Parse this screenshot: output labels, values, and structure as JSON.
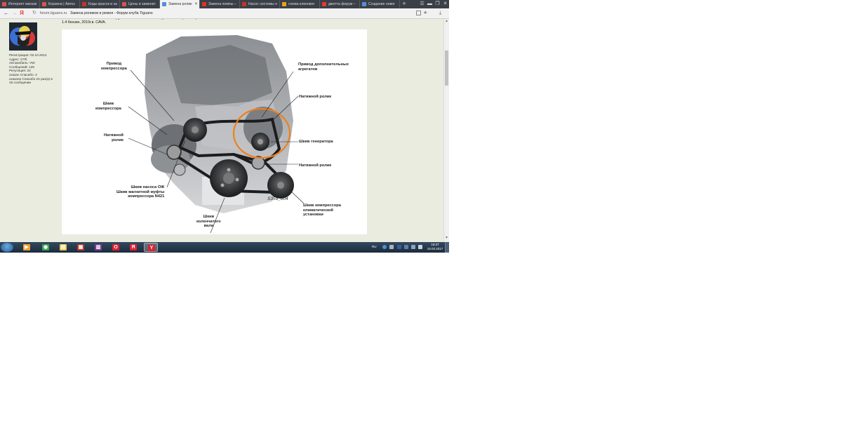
{
  "browser": {
    "tabs": [
      {
        "label": "Интернет магази",
        "color": "#d9534f"
      },
      {
        "label": "Корзина | Автоз",
        "color": "#d9534f"
      },
      {
        "label": "Коды красок и за",
        "color": "#c9302c"
      },
      {
        "label": "Цены и заменит",
        "color": "#d9534f"
      },
      {
        "label": "Замена ролик",
        "color": "#5b8dd6",
        "active": true
      },
      {
        "label": "Замена помпы –",
        "color": "#e52d27"
      },
      {
        "label": "Насос системы о",
        "color": "#c9302c"
      },
      {
        "label": "схема клиновог",
        "color": "#e8a317"
      },
      {
        "label": "джетта форум –",
        "color": "#e33b2e"
      },
      {
        "label": "Создание новог",
        "color": "#5b8dd6"
      }
    ],
    "new_tab": "+",
    "window_buttons": {
      "menu": "☰",
      "minimize": "▬",
      "restore": "❐",
      "close": "✕"
    },
    "nav": {
      "back": "←",
      "forward": "→",
      "yandex": "Я",
      "reload": "↻"
    },
    "url": "forum.tiguans.ru",
    "page_title": "Замена роликов и ремня - Форум клуба Tiguans"
  },
  "post": {
    "text_lines": [
      "натяжных? Связаны ли они между собой механически? Подскажите парт номер",
      "1.4 бензин, 2010г.в. CAVA."
    ]
  },
  "user": {
    "info_lines": [
      "Регистрация: 02.10.2012",
      "Адрес: СПб",
      "Автомобиль: VW",
      "Сообщений: 125",
      "Репутация: 24",
      "сказал Спасибо: 2",
      "сказали Спасибо 24 раз(а) в",
      "16 сообщении"
    ]
  },
  "diagram": {
    "labels": {
      "compressor_drive": [
        "Привод",
        "компрессора"
      ],
      "aux_drive": [
        "Привод дополнительных",
        "агрегатов"
      ],
      "tensioner_1": "Натяжной ролик",
      "compressor_pulley": [
        "Шкив",
        "компрессора"
      ],
      "generator_pulley": "Шкив генератора",
      "tensioner_left": [
        "Натяжной",
        "ролик"
      ],
      "tensioner_2": "Натяжной ролик",
      "pump_pulley": [
        "Шкив насоса ОЖ",
        "Шкив магнитной муфты",
        "компрессора N421"
      ],
      "ac_pulley": [
        "Шкив компрессора",
        "климатической",
        "установки"
      ],
      "crank_pulley": [
        "Шкив",
        "коленчатого",
        "вала"
      ]
    },
    "code": "S359_004",
    "highlight_color": "#f07f1c"
  },
  "taskbar": {
    "apps": [
      {
        "name": "media",
        "color": "#f0a030",
        "glyph": "▶"
      },
      {
        "name": "explorer",
        "color": "#3da35a",
        "glyph": "◉"
      },
      {
        "name": "folder",
        "color": "#e8c95a",
        "glyph": "▤"
      },
      {
        "name": "app4",
        "color": "#c0392b",
        "glyph": "▦"
      },
      {
        "name": "winrar",
        "color": "#7d3c98",
        "glyph": "▥"
      },
      {
        "name": "opera",
        "color": "#e0202f",
        "glyph": "O"
      },
      {
        "name": "yandex-1",
        "color": "#e0202f",
        "glyph": "Я"
      },
      {
        "name": "yandex-2",
        "color": "#e0202f",
        "glyph": "Y",
        "active": true
      }
    ],
    "lang": "RU",
    "time": "18:37",
    "date": "19.03.2017"
  }
}
